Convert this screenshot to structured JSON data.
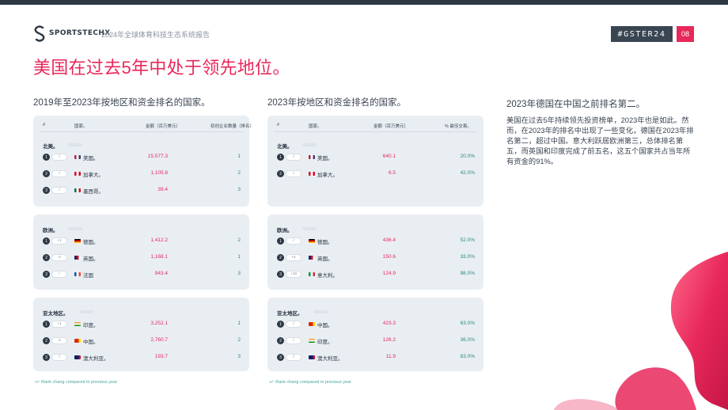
{
  "brand": {
    "name": "SPORTSTECHX",
    "report": "2024年全球体育科技生态系统报告",
    "tag": "#GSTER24",
    "page": "08",
    "accent": "#e8285a",
    "dark": "#2d3844",
    "teal": "#2a8a7e"
  },
  "headline": "美国在过去5年中处于领先地位。",
  "left": {
    "title": "2019年至2023年按地区和资金排名的国家。",
    "headers": {
      "rank": "#",
      "country": "国家。",
      "value": "金额（百万美元）",
      "last": "初创企业数量（排名）"
    },
    "regions": [
      {
        "name": "北美。",
        "rows": [
          {
            "rank": "1",
            "chg": "/",
            "flag": "us",
            "country": "美国。",
            "value": "15,577.3",
            "last": "1"
          },
          {
            "rank": "2",
            "chg": "/",
            "flag": "ca",
            "country": "加拿大。",
            "value": "1,105.8",
            "last": "2"
          },
          {
            "rank": "3",
            "chg": "/",
            "flag": "mx",
            "country": "墨西哥。",
            "value": "39.4",
            "last": "3"
          }
        ]
      },
      {
        "name": "欧洲。",
        "rows": [
          {
            "rank": "1",
            "chg": "+1",
            "flag": "de",
            "country": "德国。",
            "value": "1,412.2",
            "last": "2"
          },
          {
            "rank": "2",
            "chg": "-1",
            "flag": "gb",
            "country": "英国。",
            "value": "1,168.1",
            "last": "1"
          },
          {
            "rank": "3",
            "chg": "/",
            "flag": "fr",
            "country": "法国",
            "value": "943.4",
            "last": "3"
          }
        ]
      },
      {
        "name": "亚太地区。",
        "rows": [
          {
            "rank": "1",
            "chg": "+1",
            "flag": "in",
            "country": "印度。",
            "value": "3,252.1",
            "last": "1"
          },
          {
            "rank": "2",
            "chg": "-1",
            "flag": "cn",
            "country": "中国。",
            "value": "2,760.7",
            "last": "2"
          },
          {
            "rank": "3",
            "chg": "/",
            "flag": "au",
            "country": "澳大利亚。",
            "value": "193.7",
            "last": "3"
          }
        ]
      }
    ],
    "footnote": "+/- Rank chang compared to previous year"
  },
  "middle": {
    "title": "2023年按地区和资金排名的国家。",
    "headers": {
      "rank": "#",
      "country": "国家。",
      "value": "金额（百万美元）",
      "last": "% 最佳交易。"
    },
    "regions": [
      {
        "name": "北美。",
        "rows": [
          {
            "rank": "1",
            "chg": "/",
            "flag": "us",
            "country": "美国。",
            "value": "640.1",
            "last": "20.0%"
          },
          {
            "rank": "2",
            "chg": "/",
            "flag": "ca",
            "country": "加拿大。",
            "value": "6.5",
            "last": "42.0%"
          }
        ]
      },
      {
        "name": "欧洲。",
        "rows": [
          {
            "rank": "1",
            "chg": "/",
            "flag": "de",
            "country": "德国。",
            "value": "436.4",
            "last": "52.0%"
          },
          {
            "rank": "2",
            "chg": "+1",
            "flag": "gb",
            "country": "英国。",
            "value": "150.6",
            "last": "33.0%"
          },
          {
            "rank": "3",
            "chg": "+10",
            "flag": "it",
            "country": "意大利。",
            "value": "124.9",
            "last": "98.0%"
          }
        ]
      },
      {
        "name": "亚太地区。",
        "rows": [
          {
            "rank": "1",
            "chg": "/",
            "flag": "cn",
            "country": "中国。",
            "value": "423.3",
            "last": "63.0%"
          },
          {
            "rank": "2",
            "chg": "/",
            "flag": "in",
            "country": "印度。",
            "value": "126.2",
            "last": "36.0%"
          },
          {
            "rank": "3",
            "chg": "/",
            "flag": "au",
            "country": "澳大利亚。",
            "value": "11.9",
            "last": "83.0%"
          }
        ]
      }
    ],
    "footnote": "+/- Rank chang compared to previous year"
  },
  "right": {
    "title": "2023年德国在中国之前排名第二。",
    "text": "美国在过去5年持续领先投资榜单，2023年也是如此。然而，在2023年的排名中出现了一些变化，德国在2023年排名第二，超过中国。意大利跃居欧洲第三，总体排名第五，而英国和印度完成了前五名，这五个国家共占当年所有资金的91%。"
  }
}
